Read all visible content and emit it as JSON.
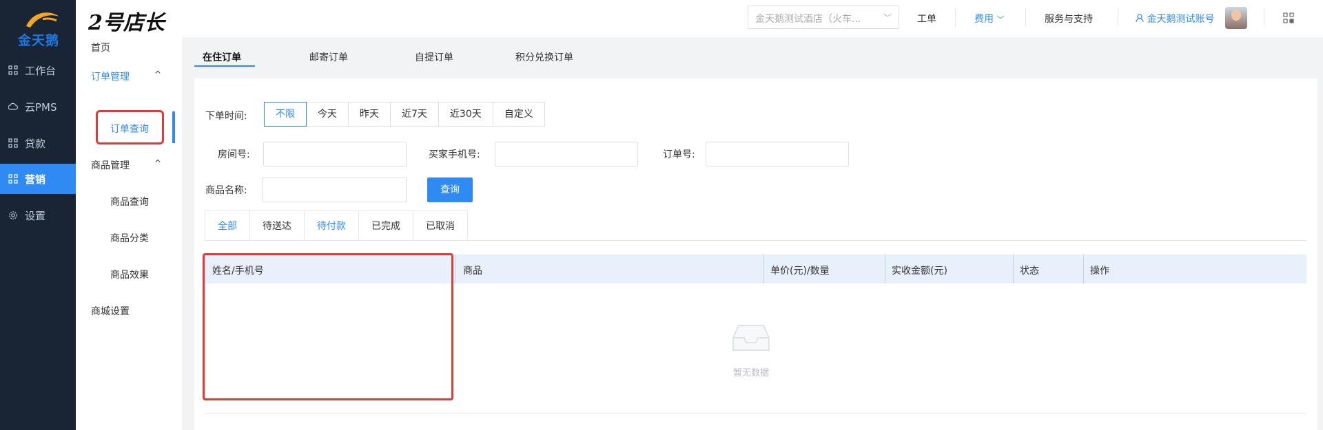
{
  "sidebar": {
    "logo_text": "金天鹅",
    "items": [
      {
        "label": "工作台",
        "icon": "grid-icon"
      },
      {
        "label": "云PMS",
        "icon": "cloud-icon"
      },
      {
        "label": "贷款",
        "icon": "grid-icon"
      },
      {
        "label": "营销",
        "icon": "grid-icon",
        "active": true
      },
      {
        "label": "设置",
        "icon": "gear-icon"
      }
    ]
  },
  "subnav": {
    "home": "首页",
    "order_mgmt": "订单管理",
    "order_query": "订单查询",
    "goods_mgmt": "商品管理",
    "goods_query": "商品查询",
    "goods_category": "商品分类",
    "goods_effect": "商品效果",
    "mall_settings": "商城设置",
    "caret": "^"
  },
  "header": {
    "brand": "2号店长",
    "store_select": "金天鹅测试酒店（火车...",
    "links": {
      "workorder": "工单",
      "fees": "费用",
      "service": "服务与支持",
      "account": "金天鹅测试账号"
    }
  },
  "top_tabs": [
    "在住订单",
    "邮寄订单",
    "自提订单",
    "积分兑换订单"
  ],
  "filters": {
    "order_time_label": "下单时间:",
    "time_options": [
      "不限",
      "今天",
      "昨天",
      "近7天",
      "近30天",
      "自定义"
    ],
    "room_label": "房间号:",
    "phone_label": "买家手机号:",
    "order_no_label": "订单号:",
    "goods_name_label": "商品名称:",
    "query_button": "查询"
  },
  "status_tabs": [
    "全部",
    "待送达",
    "待付款",
    "已完成",
    "已取消"
  ],
  "table": {
    "columns": [
      "姓名/手机号",
      "商品",
      "单价(元)/数量",
      "实收金额(元)",
      "状态",
      "操作"
    ],
    "empty_text": "暂无数据"
  },
  "colors": {
    "accent": "#2f8bf3",
    "sidebar_bg": "#192435",
    "highlight": "#e53935"
  }
}
